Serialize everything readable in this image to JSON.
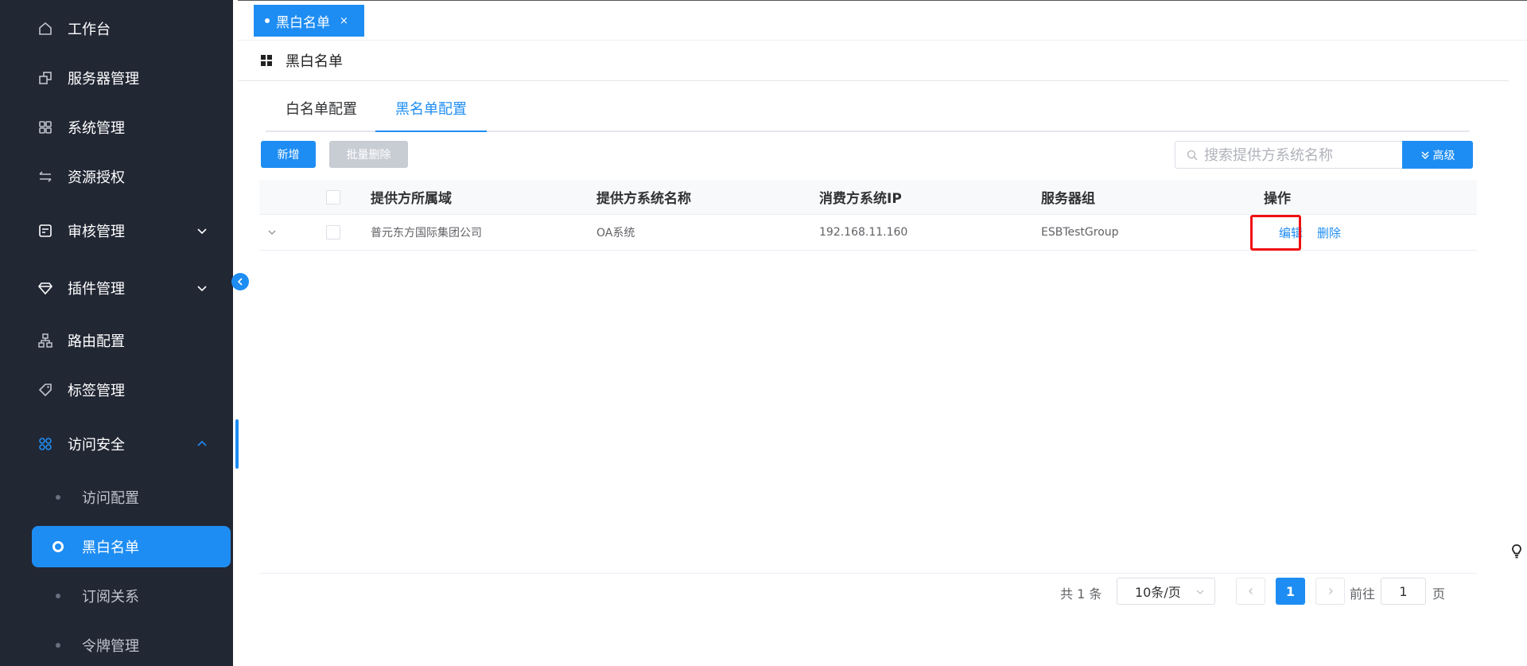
{
  "sidebar": {
    "items": [
      {
        "label": "工作台",
        "icon": "home-icon"
      },
      {
        "label": "服务器管理",
        "icon": "server-icon"
      },
      {
        "label": "系统管理",
        "icon": "apps-icon"
      },
      {
        "label": "资源授权",
        "icon": "transfer-icon"
      },
      {
        "label": "审核管理",
        "icon": "audit-icon",
        "expandable": true
      },
      {
        "label": "插件管理",
        "icon": "diamond-icon",
        "expandable": true
      },
      {
        "label": "路由配置",
        "icon": "network-icon"
      },
      {
        "label": "标签管理",
        "icon": "tag-icon"
      },
      {
        "label": "访问安全",
        "icon": "security-icon",
        "expanded": true
      }
    ],
    "submenu": [
      {
        "label": "访问配置"
      },
      {
        "label": "黑白名单",
        "active": true
      },
      {
        "label": "订阅关系"
      },
      {
        "label": "令牌管理"
      }
    ]
  },
  "tabbar": {
    "active_tab": "黑白名单",
    "close": "×"
  },
  "header": {
    "title": "黑白名单"
  },
  "tabs": [
    {
      "label": "白名单配置"
    },
    {
      "label": "黑名单配置",
      "active": true
    }
  ],
  "toolbar": {
    "add_label": "新增",
    "batch_delete_label": "批量删除",
    "search_placeholder": "搜索提供方系统名称",
    "advanced_label": "高级"
  },
  "table": {
    "columns": [
      "提供方所属域",
      "提供方系统名称",
      "消费方系统IP",
      "服务器组",
      "操作"
    ],
    "rows": [
      {
        "domain": "普元东方国际集团公司",
        "system_name": "OA系统",
        "consumer_ip": "192.168.11.160",
        "server_group": "ESBTestGroup",
        "edit": "编辑",
        "delete": "删除"
      }
    ]
  },
  "pagination": {
    "total": "共 1 条",
    "page_size": "10条/页",
    "current_page": "1",
    "goto_label": "前往",
    "goto_value": "1",
    "page_unit": "页"
  },
  "colors": {
    "primary": "#1e8df3",
    "sidebar_bg": "#222734",
    "highlight": "#f01010"
  }
}
